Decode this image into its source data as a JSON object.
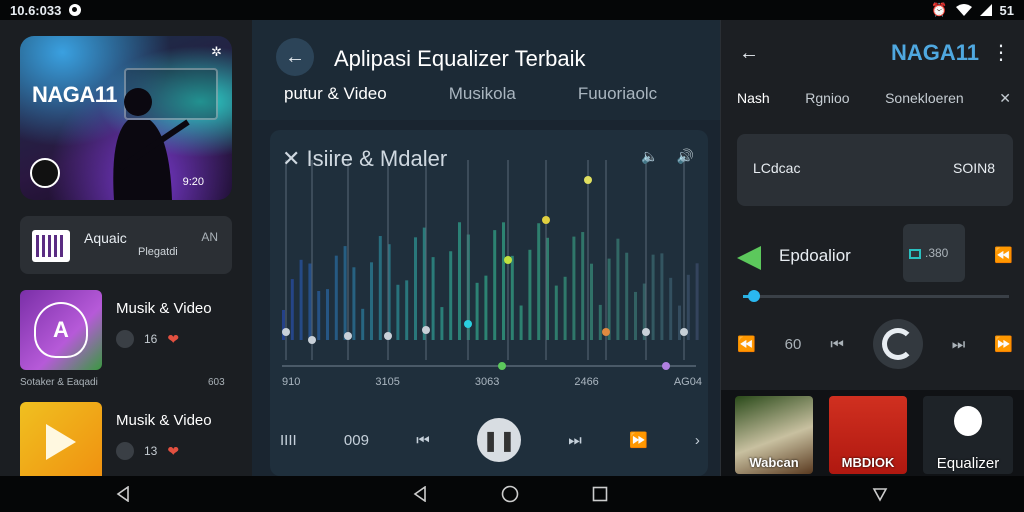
{
  "status": {
    "time": "10.6:033",
    "battery": "51"
  },
  "left": {
    "hero": {
      "title": "NAGA11",
      "time": "9:20"
    },
    "row": {
      "name": "Aquaic",
      "sub": "Plegatdi",
      "tag": "AN"
    },
    "cards": [
      {
        "name": "Musik & Video",
        "count": "16"
      },
      {
        "name": "Musik & Video",
        "count": "13"
      }
    ],
    "caption_left": "Sotaker & Eaqadi",
    "caption_right": "603"
  },
  "mid": {
    "title": "Aplipasi Equalizer Terbaik",
    "tabs": [
      "putur & Video",
      "Musikola",
      "Fuuoriaolc"
    ],
    "eq_title": "Isiire & Mdaler",
    "freq_labels": [
      "910",
      "3105",
      "3063",
      "2466",
      "AG04"
    ],
    "left_label": "IIII",
    "counter": "009"
  },
  "right": {
    "brand": "NAGA11",
    "tabs": [
      "Nash",
      "Rgnioo",
      "Sonekloeren"
    ],
    "box_left": "LCdcac",
    "box_right": "SOIN8",
    "eq_label": "Epdoalior",
    "chip_value": ".380",
    "slider_value": 0.04,
    "counter": "60",
    "tiles": [
      {
        "label": "Wabcan"
      },
      {
        "label": "MBDIOK"
      },
      {
        "label": "Equalizer"
      }
    ]
  },
  "colors": {
    "accent": "#2ab8f0",
    "brand": "#4fa8e0",
    "eq_green": "#5cc85c"
  }
}
